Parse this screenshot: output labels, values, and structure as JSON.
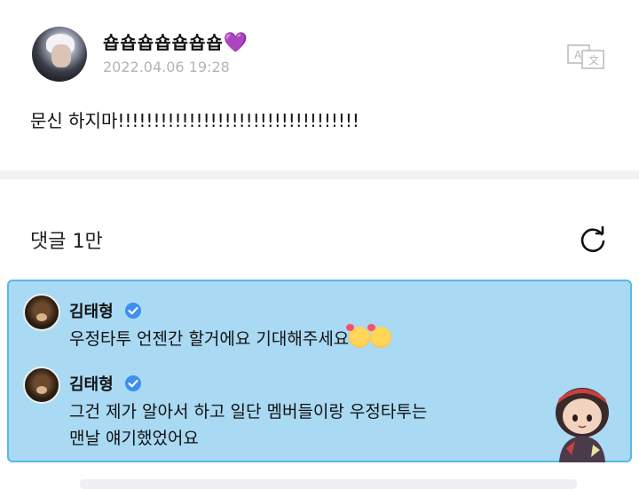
{
  "post": {
    "username": "숍숍숍숍숍숍숍",
    "heart": "💜",
    "timestamp": "2022.04.06 19:28",
    "text": "문신 하지마!!!!!!!!!!!!!!!!!!!!!!!!!!!!!!!!!!"
  },
  "comments_header": "댓글 1만",
  "comments": [
    {
      "name": "김태형",
      "text": "우정타투 언젠간 할거에요 기대해주세요"
    },
    {
      "name": "김태형",
      "text_line1": "그건 제가 알아서 하고 일단 멤버들이랑 우정타투는",
      "text_line2": "맨날 얘기했었어요"
    }
  ],
  "colors": {
    "highlight_bg": "#a9d9f3",
    "highlight_border": "#59b8e8",
    "verified": "#3d8ff0",
    "heart": "#9b30ff"
  },
  "icons": [
    "translate-icon",
    "refresh-icon",
    "verified-badge-icon",
    "smiling-hearts-emoji-icon",
    "tinytan-sticker-icon"
  ]
}
